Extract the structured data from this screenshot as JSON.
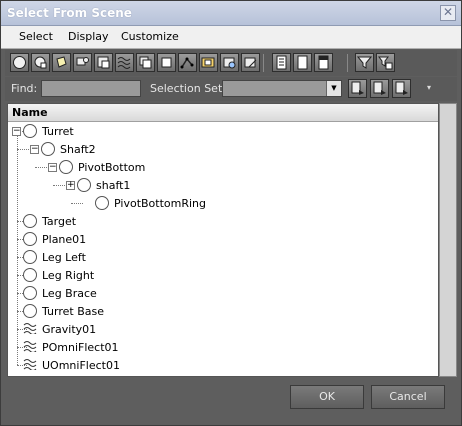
{
  "window": {
    "title": "Select From Scene",
    "close_glyph": "✕"
  },
  "menu": {
    "items": [
      "Select",
      "Display",
      "Customize"
    ]
  },
  "toolbar": {
    "buttons": [
      "display-geometry-icon",
      "display-shapes-icon",
      "display-lights-icon",
      "display-cameras-icon",
      "display-helpers-icon",
      "display-spacewarps-icon",
      "display-groups-icon",
      "display-xrefs-icon",
      "display-bones-icon",
      "display-containers-icon",
      "display-frozen-icon",
      "display-hidden-icon",
      "select-all-icon",
      "select-none-icon",
      "select-invert-icon",
      "filter-icon",
      "filter-options-icon"
    ]
  },
  "find": {
    "label": "Find:",
    "value": "",
    "selection_set_label": "Selection Set:",
    "selection_set_value": ""
  },
  "list": {
    "column_header": "Name",
    "rows": [
      {
        "label": "Turret",
        "level": 0,
        "expander": "−",
        "icon": "geometry-circle-icon"
      },
      {
        "label": "Shaft2",
        "level": 1,
        "expander": "−",
        "icon": "geometry-circle-icon"
      },
      {
        "label": "PivotBottom",
        "level": 2,
        "expander": "−",
        "icon": "geometry-circle-icon"
      },
      {
        "label": "shaft1",
        "level": 3,
        "expander": "+",
        "icon": "geometry-circle-icon"
      },
      {
        "label": "PivotBottomRing",
        "level": 4,
        "expander": "",
        "icon": "geometry-circle-icon"
      },
      {
        "label": "Target",
        "level": 0,
        "expander": "",
        "icon": "geometry-circle-icon"
      },
      {
        "label": "Plane01",
        "level": 0,
        "expander": "",
        "icon": "geometry-circle-icon"
      },
      {
        "label": "Leg Left",
        "level": 0,
        "expander": "",
        "icon": "geometry-circle-icon"
      },
      {
        "label": "Leg Right",
        "level": 0,
        "expander": "",
        "icon": "geometry-circle-icon"
      },
      {
        "label": "Leg Brace",
        "level": 0,
        "expander": "",
        "icon": "geometry-circle-icon"
      },
      {
        "label": "Turret Base",
        "level": 0,
        "expander": "",
        "icon": "geometry-circle-icon"
      },
      {
        "label": "Gravity01",
        "level": 0,
        "expander": "",
        "icon": "spacewarp-wave-icon"
      },
      {
        "label": "POmniFlect01",
        "level": 0,
        "expander": "",
        "icon": "spacewarp-wave-icon"
      },
      {
        "label": "UOmniFlect01",
        "level": 0,
        "expander": "",
        "icon": "spacewarp-wave-icon"
      }
    ]
  },
  "footer": {
    "ok_label": "OK",
    "cancel_label": "Cancel"
  }
}
